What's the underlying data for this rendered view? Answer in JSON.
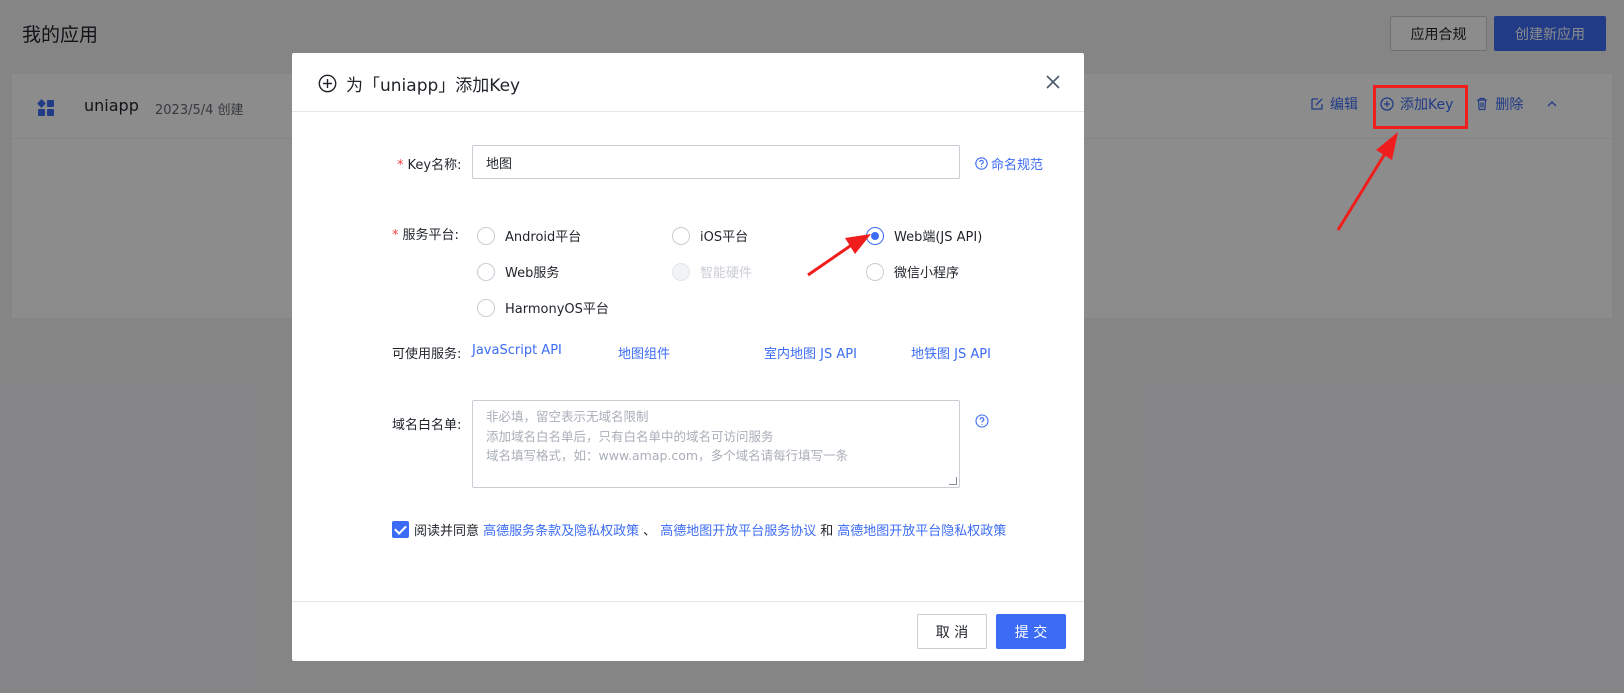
{
  "page": {
    "title": "我的应用",
    "compliance_button": "应用合规",
    "create_button": "创建新应用"
  },
  "app": {
    "name": "uniapp",
    "created": "2023/5/4 创建",
    "actions": {
      "edit": "编辑",
      "add_key": "添加Key",
      "delete": "删除"
    }
  },
  "modal": {
    "title": "为「uniapp」添加Key",
    "key_name_label": "Key名称:",
    "key_name_value": "地图",
    "naming_rules_link": "命名规范",
    "platform_label": "服务平台:",
    "platforms": [
      {
        "label": "Android平台",
        "checked": false,
        "disabled": false
      },
      {
        "label": "iOS平台",
        "checked": false,
        "disabled": false
      },
      {
        "label": "Web端(JS API)",
        "checked": true,
        "disabled": false
      },
      {
        "label": "Web服务",
        "checked": false,
        "disabled": false
      },
      {
        "label": "智能硬件",
        "checked": false,
        "disabled": true
      },
      {
        "label": "微信小程序",
        "checked": false,
        "disabled": false
      },
      {
        "label": "HarmonyOS平台",
        "checked": false,
        "disabled": false
      }
    ],
    "services_label": "可使用服务:",
    "services": [
      "JavaScript API",
      "地图组件",
      "室内地图 JS API",
      "地铁图 JS API"
    ],
    "whitelist_label": "域名白名单:",
    "whitelist_placeholder_lines": [
      "非必填，留空表示无域名限制",
      "添加域名白名单后，只有白名单中的域名可访问服务",
      "域名填写格式，如：www.amap.com，多个域名请每行填写一条"
    ],
    "agree": {
      "prefix": "阅读并同意",
      "link1": "高德服务条款及隐私权政策",
      "sep1": "、",
      "link2": "高德地图开放平台服务协议",
      "sep2": "和",
      "link3": "高德地图开放平台隐私权政策",
      "checked": true
    },
    "cancel_button": "取 消",
    "submit_button": "提 交"
  },
  "colors": {
    "accent": "#3c6cf5",
    "required": "#f53f3f",
    "annotation": "#f01d1d"
  }
}
